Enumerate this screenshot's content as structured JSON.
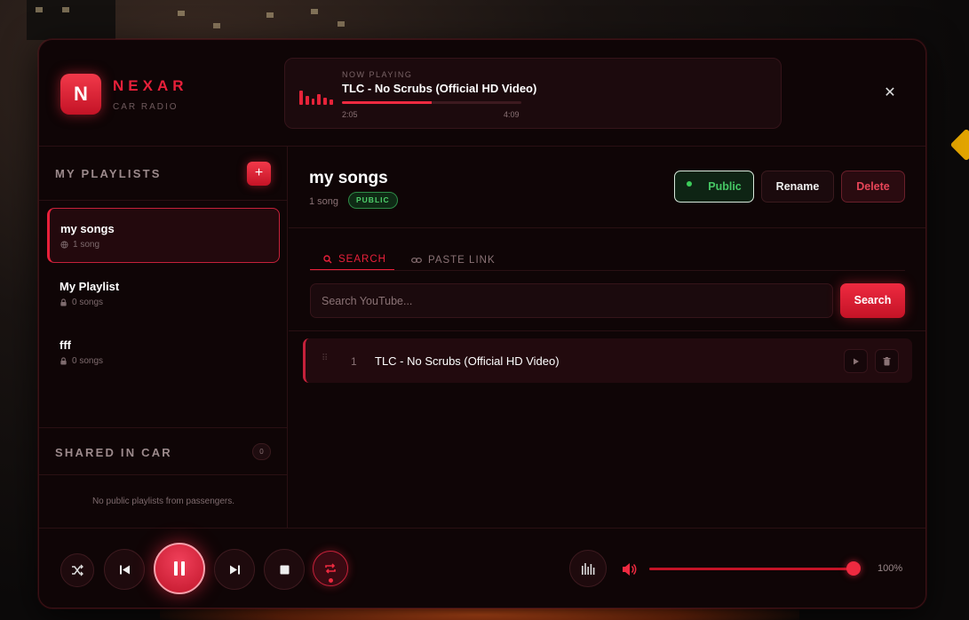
{
  "brand": {
    "logo_letter": "N",
    "name": "NEXAR",
    "subtitle": "CAR RADIO"
  },
  "now_playing": {
    "label": "NOW PLAYING",
    "title": "TLC - No Scrubs (Official HD Video)",
    "current_time": "2:05",
    "duration": "4:09",
    "progress_fraction": 0.5
  },
  "sidebar": {
    "title": "MY PLAYLISTS",
    "add_label": "+",
    "playlists": [
      {
        "name": "my songs",
        "meta": "1 song",
        "visibility_icon": "globe-icon",
        "active": true
      },
      {
        "name": "My Playlist",
        "meta": "0 songs",
        "visibility_icon": "lock-icon",
        "active": false
      },
      {
        "name": "fff",
        "meta": "0 songs",
        "visibility_icon": "lock-icon",
        "active": false
      }
    ],
    "shared": {
      "title": "SHARED IN CAR",
      "count": "0",
      "empty_text": "No public playlists from passengers."
    }
  },
  "main": {
    "title": "my songs",
    "song_count": "1 song",
    "badge": "PUBLIC",
    "buttons": {
      "public": "Public",
      "rename": "Rename",
      "delete": "Delete"
    },
    "tabs": [
      {
        "label": "SEARCH",
        "icon": "search-icon"
      },
      {
        "label": "PASTE LINK",
        "icon": "link-icon"
      }
    ],
    "search": {
      "placeholder": "Search YouTube...",
      "value": "",
      "button": "Search"
    },
    "songs": [
      {
        "num": "1",
        "title": "TLC - No Scrubs (Official HD Video)"
      }
    ]
  },
  "player": {
    "volume_text": "100%",
    "volume_fraction": 1.0,
    "repeat_active": true,
    "playing": true
  },
  "colors": {
    "accent": "#e8203a",
    "public_green": "#46c865",
    "panel_bg": "#0f0506"
  }
}
